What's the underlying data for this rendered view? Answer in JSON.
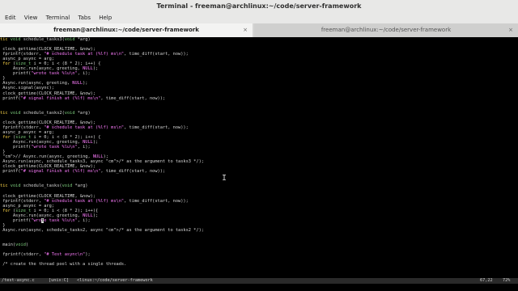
{
  "window": {
    "title": "Terminal - freeman@archlinux:~/code/server-framework"
  },
  "menu": {
    "items": [
      "Edit",
      "View",
      "Terminal",
      "Tabs",
      "Help"
    ]
  },
  "tabs": [
    {
      "label": "freeman@archlinux:~/code/server-framework",
      "close": "×"
    },
    {
      "label": "freeman@archlinux:~/code/server-framework",
      "close": "×"
    }
  ],
  "code_lines": [
    "tic void schedule_tasks3(void *arg)",
    "",
    " clock_gettime(CLOCK_REALTIME, &now);",
    " fprintf(stderr, \"# schedule task at (%lf) ms\\n\", time_diff(start, now));",
    " async_p async = arg;",
    " for (size_t i = 0; i < (8 * 2); i++) {",
    "     Async.run(async, greeting, NULL);",
    "     printf(\"wrote task %lu\\n\", i);",
    " }",
    " Async.run(async, greeting, NULL);",
    " Async.signal(async);",
    " clock_gettime(CLOCK_REALTIME, &now);",
    " printf(\"# signal finish at (%lf) ms\\n\", time_diff(start, now));",
    "",
    "",
    "tic void schedule_tasks2(void *arg)",
    "",
    " clock_gettime(CLOCK_REALTIME, &now);",
    " fprintf(stderr, \"# schedule task at (%lf) ms\\n\", time_diff(start, now));",
    " async_p async = arg;",
    " for (size_t i = 0; i < (8 * 2); i++) {",
    "     Async.run(async, greeting, NULL);",
    "     printf(\"wrote task %lu\\n\", i);",
    " }",
    " // Async.run(async, greeting, NULL);",
    " Async.run(async, schedule_tasks3, async /* as the argument to tasks3 */);",
    " clock_gettime(CLOCK_REALTIME, &now);",
    " printf(\"# signal finish at (%lf) ms\\n\", time_diff(start, now));",
    "",
    "",
    "tic void schedule_tasks(void *arg)",
    "",
    " clock_gettime(CLOCK_REALTIME, &now);",
    " fprintf(stderr, \"# schedule task at (%lf) ms\\n\", time_diff(start, now));",
    " async_p async = arg;",
    " for (size_t i = 0; i < (8 * 2); i++){",
    "     Async.run(async, greeting, NULL);",
    "     printf(\"wrote task %lu\\n\", i);",
    " }",
    " Async.run(async, schedule_tasks2, async /* as the argument to tasks2 */);",
    "",
    "",
    " main(void)",
    "",
    " fprintf(stderr, \"# Test async\\n\");",
    "",
    " /* create the thread pool with a single threads."
  ],
  "status_bar": {
    "file": "/test-async.c",
    "format": "[unix:C]",
    "path": "<linux:~/code/server-framework",
    "position": "67,22",
    "percent": "72%"
  }
}
